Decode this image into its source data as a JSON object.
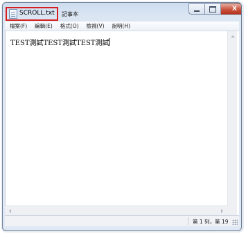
{
  "window": {
    "file_title": "SCROLL.txt",
    "app_title": "記事本",
    "minimize_glyph": "",
    "maximize_glyph": "",
    "close_glyph": "X"
  },
  "menu": [
    {
      "label": "檔案(F)"
    },
    {
      "label": "編輯(E)"
    },
    {
      "label": "格式(O)"
    },
    {
      "label": "檢視(V)"
    },
    {
      "label": "說明(H)"
    }
  ],
  "editor": {
    "content": "TEST測試TEST測試TEST測試"
  },
  "status": {
    "position": "第 1 列，第 19"
  },
  "colors": {
    "highlight_box": "#d71f1f",
    "close_button": "#c8533d"
  }
}
